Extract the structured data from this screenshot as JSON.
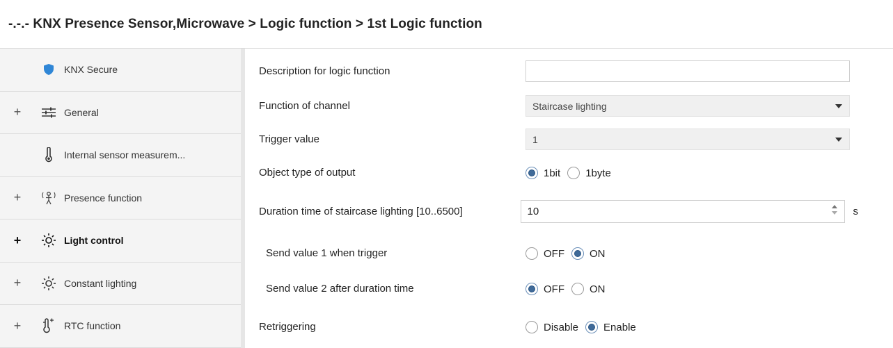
{
  "header": {
    "title": "-.-.- KNX Presence Sensor,Microwave > Logic function > 1st Logic function"
  },
  "sidebar": {
    "items": [
      {
        "label": "KNX Secure",
        "icon": "shield-icon",
        "expandable": false,
        "active": false
      },
      {
        "label": "General",
        "icon": "sliders-icon",
        "expandable": true,
        "active": false
      },
      {
        "label": "Internal sensor measurem...",
        "icon": "thermometer-icon",
        "expandable": false,
        "active": false
      },
      {
        "label": "Presence function",
        "icon": "presence-icon",
        "expandable": true,
        "active": false
      },
      {
        "label": "Light control",
        "icon": "light-icon",
        "expandable": true,
        "active": true
      },
      {
        "label": "Constant lighting",
        "icon": "sun-icon",
        "expandable": true,
        "active": false
      },
      {
        "label": "RTC function",
        "icon": "rtc-icon",
        "expandable": true,
        "active": false
      }
    ],
    "plus": "+"
  },
  "form": {
    "description": {
      "label": "Description for logic function",
      "value": ""
    },
    "function_of_channel": {
      "label": "Function of channel",
      "value": "Staircase lighting"
    },
    "trigger_value": {
      "label": "Trigger value",
      "value": "1"
    },
    "object_type": {
      "label": "Object type of  output",
      "options": [
        "1bit",
        "1byte"
      ],
      "selected": "1bit"
    },
    "duration": {
      "label": "Duration time of staircase lighting [10..6500]",
      "value": "10",
      "unit": "s"
    },
    "send_value_1": {
      "label": "Send value 1 when trigger",
      "options": [
        "OFF",
        "ON"
      ],
      "selected": "ON"
    },
    "send_value_2": {
      "label": "Send value 2 after duration time",
      "options": [
        "OFF",
        "ON"
      ],
      "selected": "OFF"
    },
    "retriggering": {
      "label": "Retriggering",
      "options": [
        "Disable",
        "Enable"
      ],
      "selected": "Enable"
    }
  },
  "colors": {
    "shield": "#2f86d6",
    "radio_selected": "#3f6a99"
  }
}
